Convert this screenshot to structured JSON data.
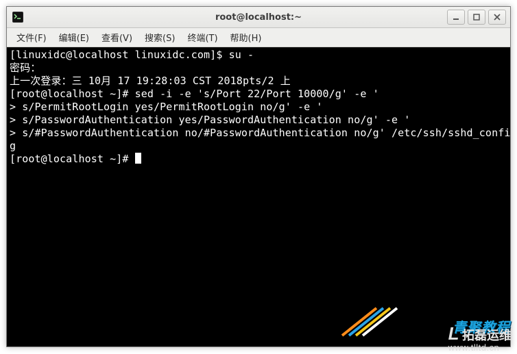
{
  "window": {
    "title": "root@localhost:~"
  },
  "menu": {
    "items": [
      "文件(F)",
      "编辑(E)",
      "查看(V)",
      "搜索(S)",
      "终端(T)",
      "帮助(H)"
    ]
  },
  "terminal": {
    "lines": [
      "[linuxidc@localhost linuxidc.com]$ su -",
      "密码：",
      "上一次登录：三 10月 17 19:28:03 CST 2018pts/2 上",
      "[root@localhost ~]# sed -i -e 's/Port 22/Port 10000/g' -e '",
      "> s/PermitRootLogin yes/PermitRootLogin no/g' -e '",
      "> s/PasswordAuthentication yes/PasswordAuthentication no/g' -e '",
      "> s/#PasswordAuthentication no/#PasswordAuthentication no/g' /etc/ssh/sshd_confi",
      "g",
      "[root@localhost ~]# "
    ]
  },
  "watermarks": {
    "top_cn": "青聚教程",
    "brand_letter": "L",
    "brand_cn": "拓磊运维",
    "brand_url": "www.tlltd.cn"
  }
}
